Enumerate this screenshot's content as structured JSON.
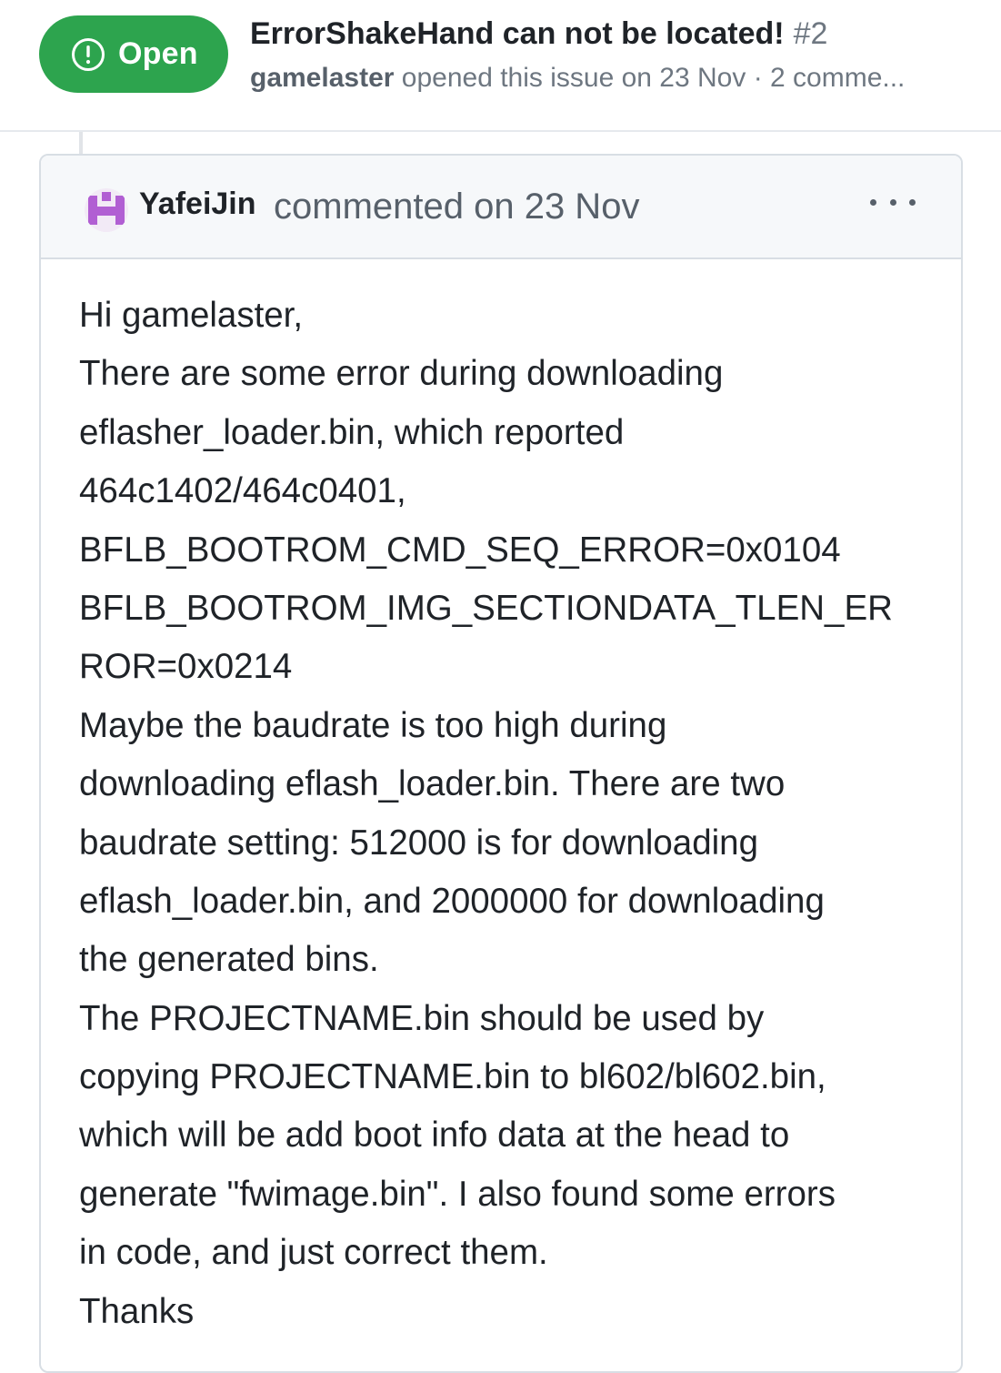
{
  "issue": {
    "state_label": "Open",
    "state_color": "#2da44e",
    "title": "ErrorShakeHand can not be located!",
    "number": "#2",
    "author": "gamelaster",
    "meta_text": " opened this issue on 23 Nov · 2 comme..."
  },
  "comment": {
    "author": "YafeiJin",
    "meta": "commented on 23 Nov",
    "more_icon": "kebab-horizontal-icon",
    "avatar_color": "#b15fd3",
    "body_lines": [
      "Hi gamelaster,",
      "There are some error during downloading",
      "eflasher_loader.bin, which reported",
      "464c1402/464c0401,",
      "BFLB_BOOTROM_CMD_SEQ_ERROR=0x0104",
      "BFLB_BOOTROM_IMG_SECTIONDATA_TLEN_ER",
      "ROR=0x0214",
      "Maybe the baudrate is too high during",
      "downloading eflash_loader.bin. There are two",
      "baudrate setting: 512000 is for downloading",
      "eflash_loader.bin, and 2000000 for downloading",
      "the generated bins.",
      "The PROJECTNAME.bin should be used by",
      "copying PROJECTNAME.bin to bl602/bl602.bin,",
      "which will be add boot info data at the head to",
      "generate \"fwimage.bin\". I also found some errors",
      "in code, and just correct them.",
      "Thanks"
    ]
  }
}
